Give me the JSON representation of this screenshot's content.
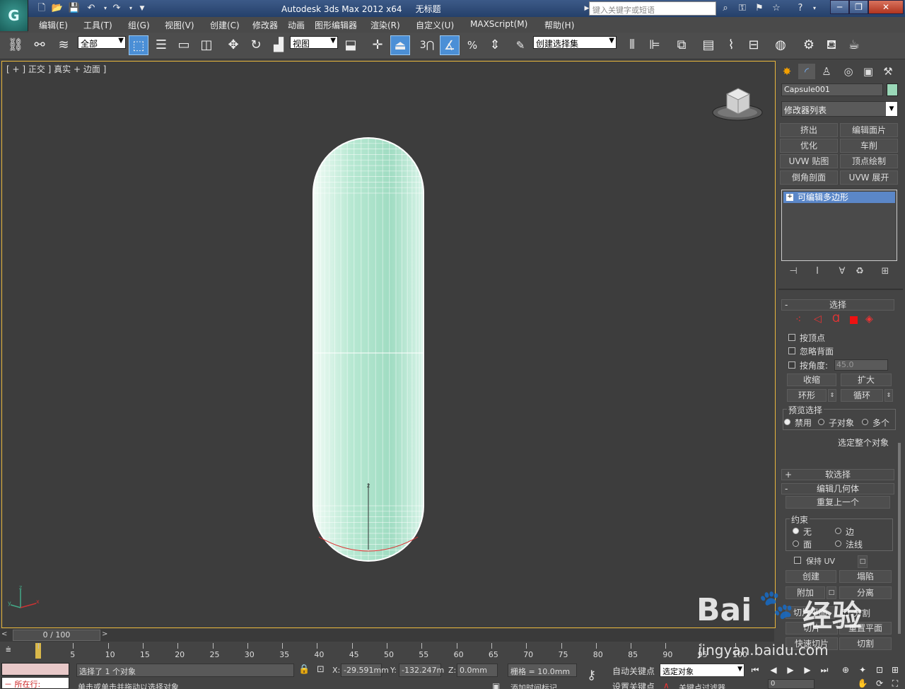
{
  "titlebar": {
    "app_title": "Autodesk 3ds Max  2012 x64",
    "doc_title": "无标题",
    "search_placeholder": "键入关键字或短语",
    "logo_glyph": "G"
  },
  "menubar": {
    "items": [
      "编辑(E)",
      "工具(T)",
      "组(G)",
      "视图(V)",
      "创建(C)",
      "修改器",
      "动画",
      "图形编辑器",
      "渲染(R)",
      "自定义(U)",
      "MAXScript(M)",
      "帮助(H)"
    ]
  },
  "toolbar": {
    "selection_filter": "全部",
    "ref_coord": "视图",
    "named_selection": "创建选择集",
    "snap_number": "3"
  },
  "viewport": {
    "label": "[ + ] 正交 ] 真实 + 边面 ]",
    "object_color": "#a9e2c9",
    "gizmo_label": "z",
    "axis_x": "x",
    "axis_y": "y",
    "axis_z": "z"
  },
  "command_panel": {
    "object_name": "Capsule001",
    "object_color": "#9ad8b8",
    "modifier_list": "修改器列表",
    "modifier_buttons": [
      "挤出",
      "编辑面片",
      "优化",
      "车削",
      "UVW 贴图",
      "顶点绘制",
      "倒角剖面",
      "UVW 展开"
    ],
    "stack_item": "可编辑多边形",
    "selection": {
      "title": "选择",
      "by_vertex": "按顶点",
      "ignore_backfacing": "忽略背面",
      "by_angle": "按角度:",
      "angle_value": "45.0",
      "shrink": "收缩",
      "grow": "扩大",
      "ring": "环形",
      "loop": "循环",
      "preview_title": "预览选择",
      "preview_off": "禁用",
      "preview_sub": "子对象",
      "preview_multi": "多个",
      "whole_object": "选定整个对象"
    },
    "soft_selection": "软选择",
    "edit_geometry": {
      "title": "编辑几何体",
      "repeat_last": "重复上一个",
      "constraints": "约束",
      "c_none": "无",
      "c_edge": "边",
      "c_face": "面",
      "c_normal": "法线",
      "preserve_uv": "保持 UV",
      "create": "创建",
      "collapse": "塌陷",
      "attach": "附加",
      "detach": "分离",
      "slice_plane": "切片平面",
      "split": "分割",
      "slice": "切片",
      "reset_plane": "重置平面",
      "quickslice": "快速切片",
      "cut": "切割"
    }
  },
  "timeline": {
    "frame_display": "0 / 100",
    "ticks": [
      "0",
      "5",
      "10",
      "15",
      "20",
      "25",
      "30",
      "35",
      "40",
      "45",
      "50",
      "55",
      "60",
      "65",
      "70",
      "75",
      "80",
      "85",
      "90",
      "95",
      "100"
    ]
  },
  "statusbar": {
    "running_label": "所在行:",
    "selection_status": "选择了 1 个对象",
    "prompt": "单击或单击并拖动以选择对象",
    "x_label": "X:",
    "x_value": "-29.591mm",
    "y_label": "Y:",
    "y_value": "-132.247m",
    "z_label": "Z:",
    "z_value": "0.0mm",
    "grid": "栅格 = 10.0mm",
    "add_time_tag": "添加时间标记",
    "auto_key": "自动关键点",
    "set_key": "设置关键点",
    "key_mode": "选定对象",
    "key_filters": "关键点过滤器...",
    "frame_value": "0"
  },
  "watermark": {
    "brand": "Bai",
    "brand2": "经验",
    "url": "jingyan.baidu.com"
  }
}
